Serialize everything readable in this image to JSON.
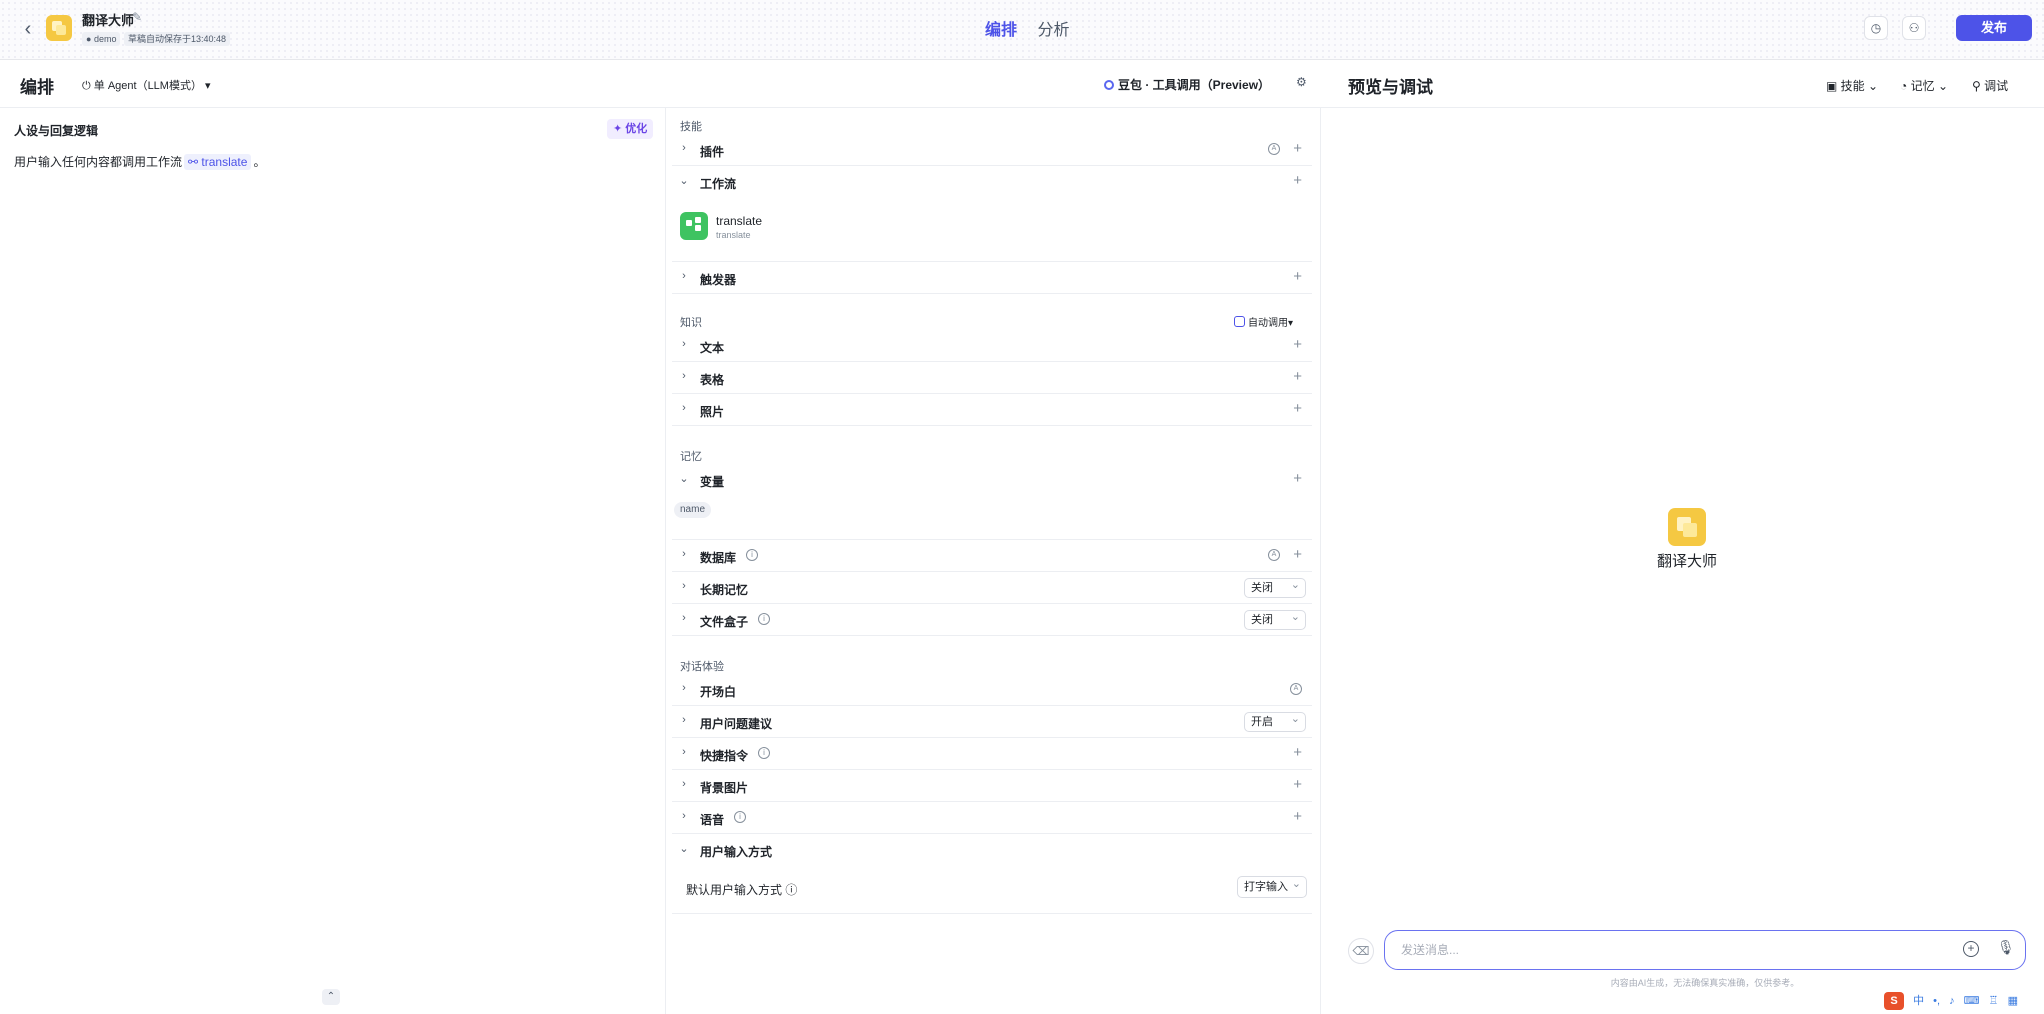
{
  "header": {
    "bot_name": "翻译大师",
    "user_tag": "demo",
    "save_status": "草稿自动保存于13:40:48",
    "tabs": [
      "编排",
      "分析"
    ],
    "publish_label": "发布"
  },
  "subbar": {
    "title": "编排",
    "mode": "单 Agent（LLM模式）",
    "model": "豆包 · 工具调用（Preview）",
    "preview_title": "预览与调试",
    "tools": [
      "技能",
      "记忆",
      "调试"
    ]
  },
  "persona": {
    "title": "人设与回复逻辑",
    "optimize_label": "优化",
    "text_before": "用户输入任何内容都调用工作流",
    "workflow_ref": "translate",
    "text_after": "。"
  },
  "skills": {
    "section_skills": "技能",
    "plugin": "插件",
    "workflow": "工作流",
    "workflow_item": {
      "name": "translate",
      "desc": "translate"
    },
    "trigger": "触发器",
    "section_knowledge": "知识",
    "auto_invoke": "自动调用",
    "text": "文本",
    "table": "表格",
    "photo": "照片",
    "section_memory": "记忆",
    "variable": "变量",
    "variable_chip": "name",
    "database": "数据库",
    "long_term_memory": "长期记忆",
    "long_term_memory_value": "关闭",
    "file_box": "文件盒子",
    "file_box_value": "关闭",
    "section_dialog": "对话体验",
    "opening": "开场白",
    "question_suggest": "用户问题建议",
    "question_suggest_value": "开启",
    "shortcut": "快捷指令",
    "background": "背景图片",
    "voice": "语音",
    "input_mode": "用户输入方式",
    "default_input_label": "默认用户输入方式",
    "default_input_value": "打字输入"
  },
  "chat": {
    "bot_name": "翻译大师",
    "placeholder": "发送消息...",
    "disclaimer": "内容由AI生成，无法确保真实准确，仅供参考。"
  },
  "tray": {
    "ime": "中"
  }
}
